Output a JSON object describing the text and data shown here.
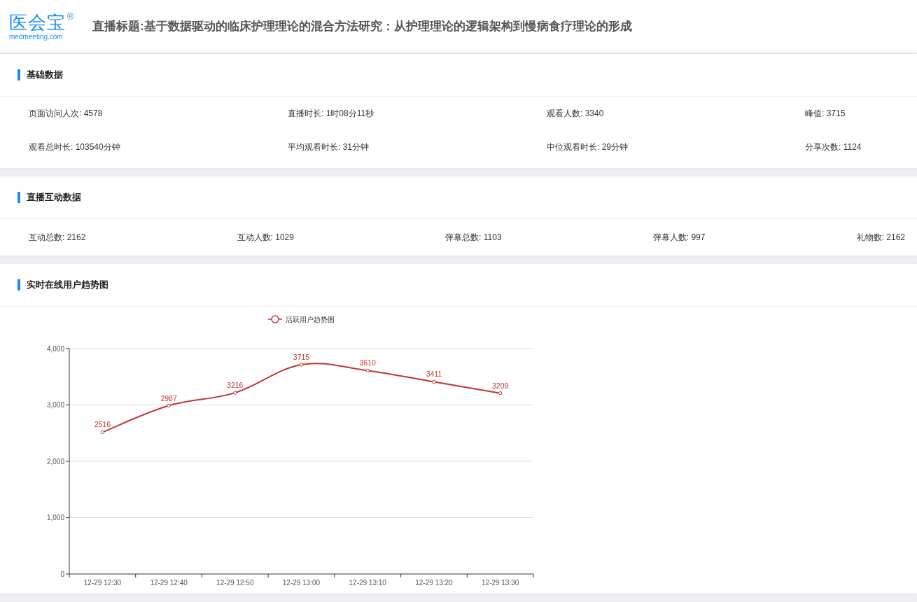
{
  "logo": {
    "name": "医会宝",
    "mark": "®",
    "domain": "medmeeting.com"
  },
  "page_title": "直播标题:基于数据驱动的临床护理理论的混合方法研究：从护理理论的逻辑架构到慢病食疗理论的形成",
  "basic_data": {
    "title": "基础数据",
    "stats": [
      {
        "text": "页面访问人次: 4578"
      },
      {
        "text": "直播时长: 1时08分11秒"
      },
      {
        "text": "观看人数: 3340"
      },
      {
        "text": "峰值: 3715"
      },
      {
        "text": "观看总时长: 103540分钟"
      },
      {
        "text": "平均观看时长: 31分钟"
      },
      {
        "text": "中位观看时长: 29分钟"
      },
      {
        "text": "分享次数: 1124"
      }
    ]
  },
  "interaction_data": {
    "title": "直播互动数据",
    "stats": [
      {
        "text": "互动总数: 2162"
      },
      {
        "text": "互动人数: 1029"
      },
      {
        "text": "弹幕总数: 1103"
      },
      {
        "text": "弹幕人数: 997"
      },
      {
        "text": "礼物数: 2162"
      }
    ]
  },
  "trend": {
    "title": "实时在线用户趋势图",
    "chart_data": {
      "type": "line",
      "categories": [
        "12-29 12:30",
        "12-29 12:40",
        "12-29 12:50",
        "12-29 13:00",
        "12-29 13:10",
        "12-29 13:20",
        "12-29 13:30"
      ],
      "series": [
        {
          "name": "活跃用户趋势图",
          "color": "#c23531",
          "marker": "circle",
          "values": [
            2516,
            2987,
            3216,
            3715,
            3610,
            3411,
            3209
          ]
        }
      ],
      "grid": true,
      "ylim": [
        0,
        4000
      ],
      "yticks": [
        {
          "value": 0,
          "label": "0"
        },
        {
          "value": 1000,
          "label": "1,000"
        },
        {
          "value": 2000,
          "label": "2,000"
        },
        {
          "value": 3000,
          "label": "3,000"
        },
        {
          "value": 4000,
          "label": "4,000"
        }
      ],
      "data_labels": true
    }
  }
}
